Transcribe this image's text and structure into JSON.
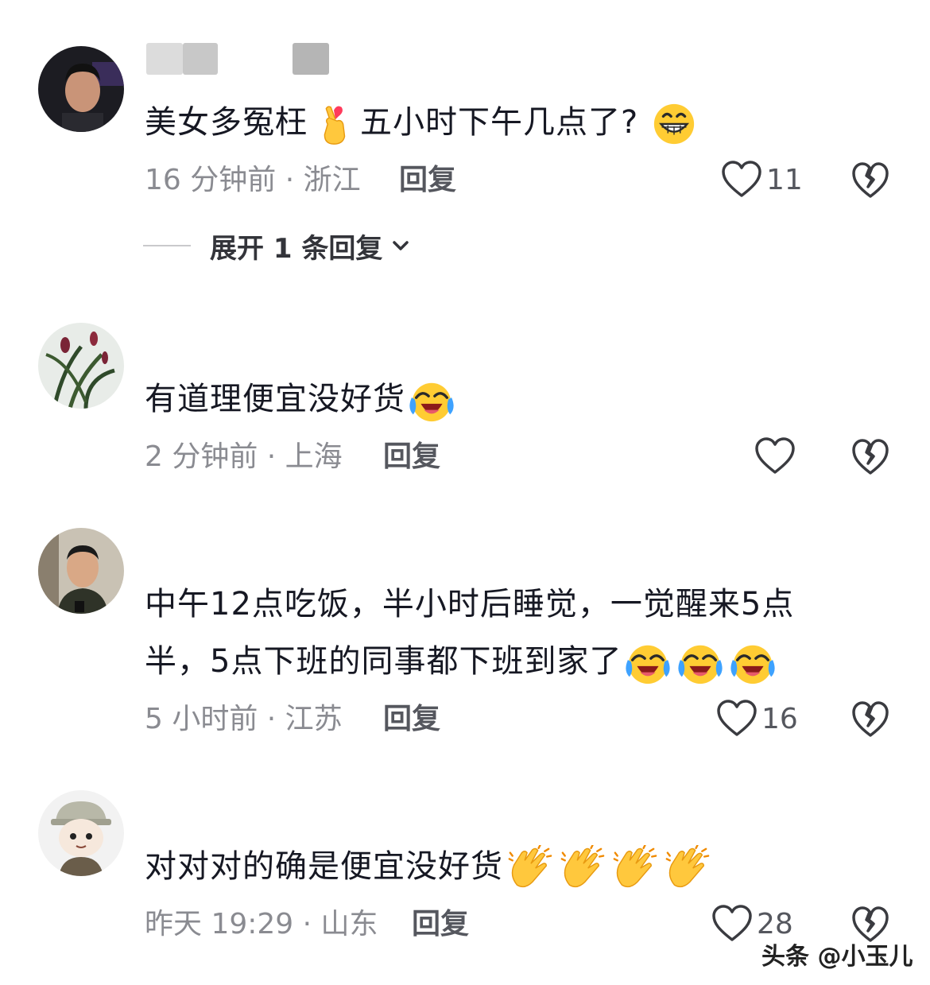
{
  "comments": [
    {
      "username": "",
      "text_before": "美女多冤枉",
      "text_after": "五小时下午几点了?",
      "time_location": "16 分钟前 · 浙江",
      "reply_label": "回复",
      "likes": "11"
    },
    {
      "username": "",
      "text_before": "有道理便宜没好货",
      "time_location": "2 分钟前 · 上海",
      "reply_label": "回复",
      "likes": ""
    },
    {
      "username": "",
      "text_line1": "中午12点吃饭，半小时后睡觉，一觉醒来5点",
      "text_line2": "半，5点下班的同事都下班到家了",
      "time_location": "5 小时前 · 江苏",
      "reply_label": "回复",
      "likes": "16"
    },
    {
      "username": "",
      "text_before": "对对对的确是便宜没好货",
      "time_location": "昨天 19:29 · 山东",
      "reply_label": "回复",
      "likes": "28"
    }
  ],
  "expand_replies": "展开 1 条回复",
  "watermark": "头条 @小玉儿",
  "icons": {
    "like": "heart-outline-icon",
    "dislike": "broken-heart-icon",
    "emoji_finger_heart": "finger-heart-emoji",
    "emoji_grin": "grinning-face-emoji",
    "emoji_cry_laugh": "loudly-crying-emoji",
    "emoji_clap": "clapping-hands-emoji"
  },
  "colors": {
    "text": "#161823",
    "meta": "#8a8b91",
    "emoji_yellow": "#ffcc33"
  }
}
